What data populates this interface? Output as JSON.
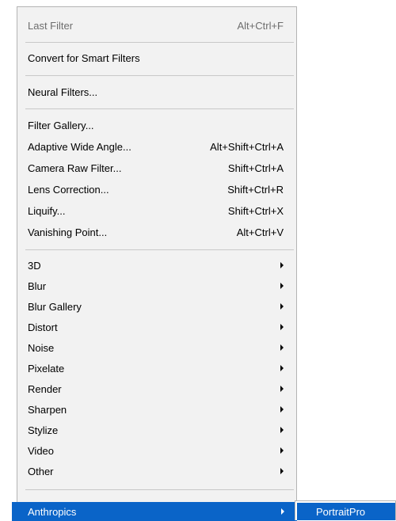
{
  "menu": {
    "last_filter": {
      "label": "Last Filter",
      "shortcut": "Alt+Ctrl+F"
    },
    "convert_smart": {
      "label": "Convert for Smart Filters"
    },
    "neural": {
      "label": "Neural Filters..."
    },
    "filter_gallery": {
      "label": "Filter Gallery..."
    },
    "adaptive": {
      "label": "Adaptive Wide Angle...",
      "shortcut": "Alt+Shift+Ctrl+A"
    },
    "camera_raw": {
      "label": "Camera Raw Filter...",
      "shortcut": "Shift+Ctrl+A"
    },
    "lens": {
      "label": "Lens Correction...",
      "shortcut": "Shift+Ctrl+R"
    },
    "liquify": {
      "label": "Liquify...",
      "shortcut": "Shift+Ctrl+X"
    },
    "vanishing": {
      "label": "Vanishing Point...",
      "shortcut": "Alt+Ctrl+V"
    },
    "submenus": [
      {
        "label": "3D"
      },
      {
        "label": "Blur"
      },
      {
        "label": "Blur Gallery"
      },
      {
        "label": "Distort"
      },
      {
        "label": "Noise"
      },
      {
        "label": "Pixelate"
      },
      {
        "label": "Render"
      },
      {
        "label": "Sharpen"
      },
      {
        "label": "Stylize"
      },
      {
        "label": "Video"
      },
      {
        "label": "Other"
      }
    ],
    "plugin": {
      "label": "Anthropics"
    }
  },
  "submenu": {
    "item": {
      "label": "PortraitPro"
    }
  },
  "colors": {
    "menu_bg": "#f2f2f2",
    "highlight": "#0a64c8",
    "disabled_text": "#6d6d6d",
    "separator": "#c8c8c8"
  },
  "icons": {
    "submenu_arrow": "triangle-right"
  }
}
